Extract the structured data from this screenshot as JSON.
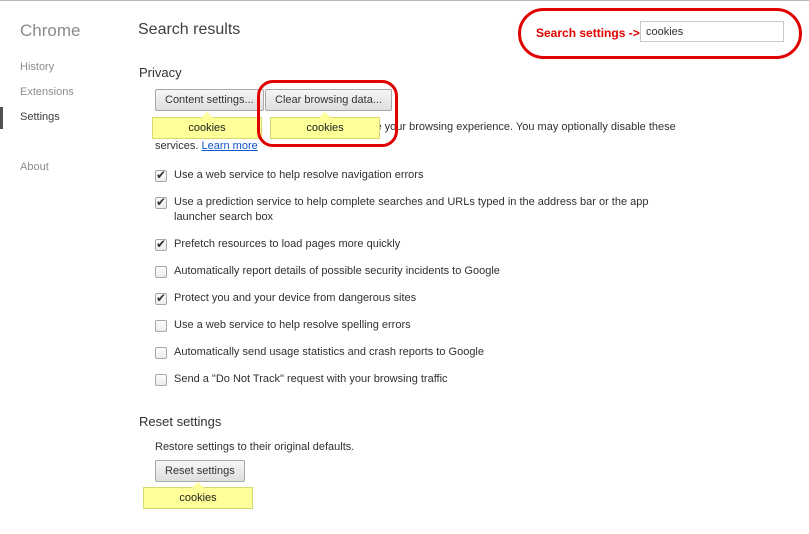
{
  "sidebar": {
    "brand": "Chrome",
    "items": [
      {
        "label": "History"
      },
      {
        "label": "Extensions"
      },
      {
        "label": "Settings"
      },
      {
        "label": "About"
      }
    ]
  },
  "header": {
    "title": "Search results",
    "search_annotation": "Search settings ->",
    "search_value": "cookies"
  },
  "privacy": {
    "title": "Privacy",
    "content_settings_label": "Content settings...",
    "clear_browsing_label": "Clear browsing data...",
    "bubble_1": "cookies",
    "bubble_2": "cookies",
    "description": "ve your browsing experience. You may optionally disable these",
    "description_line2": "services.",
    "learn_more": "Learn more",
    "options": [
      {
        "label": "Use a web service to help resolve navigation errors",
        "checked": true
      },
      {
        "label": "Use a prediction service to help complete searches and URLs typed in the address bar or the app launcher search box",
        "checked": true
      },
      {
        "label": "Prefetch resources to load pages more quickly",
        "checked": true
      },
      {
        "label": "Automatically report details of possible security incidents to Google",
        "checked": false
      },
      {
        "label": "Protect you and your device from dangerous sites",
        "checked": true
      },
      {
        "label": "Use a web service to help resolve spelling errors",
        "checked": false
      },
      {
        "label": "Automatically send usage statistics and crash reports to Google",
        "checked": false
      },
      {
        "label": "Send a \"Do Not Track\" request with your browsing traffic",
        "checked": false
      }
    ]
  },
  "reset": {
    "title": "Reset settings",
    "description": "Restore settings to their original defaults.",
    "button_label": "Reset settings",
    "bubble": "cookies"
  },
  "colors": {
    "annotation_red": "#e00000",
    "bubble_yellow": "#ffff99",
    "link_blue": "#1155cc"
  }
}
